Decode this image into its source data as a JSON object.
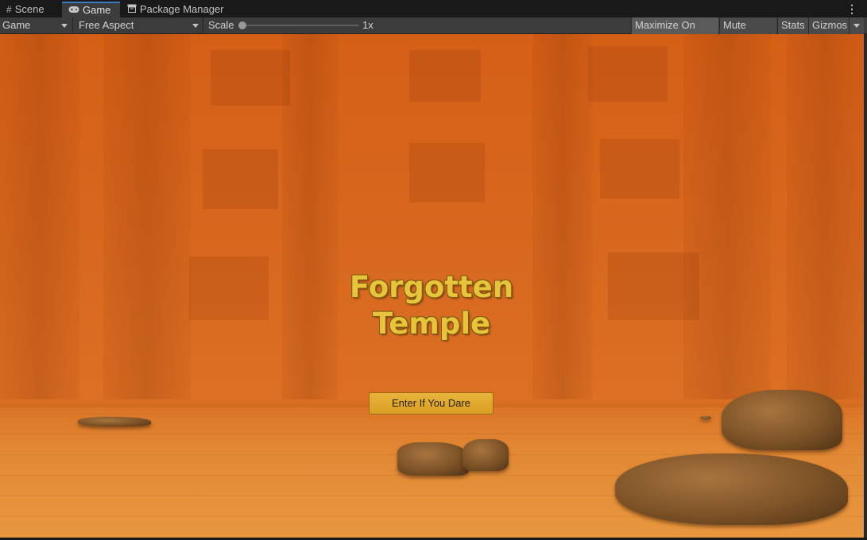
{
  "tabs": [
    {
      "label": "Scene",
      "icon": "hash-grid-icon"
    },
    {
      "label": "Game",
      "icon": "gamepad-icon",
      "active": true
    },
    {
      "label": "Package Manager",
      "icon": "package-icon"
    }
  ],
  "toolbar": {
    "display_select": "Game",
    "aspect_select": "Free Aspect",
    "scale_label": "Scale",
    "scale_value": "1x",
    "scale_level": 0.0,
    "maximize_label": "Maximize On Play",
    "mute_label": "Mute Audio",
    "stats_label": "Stats",
    "gizmos_label": "Gizmos"
  },
  "game": {
    "title_line1": "Forgotten",
    "title_line2": "Temple",
    "button_label": "Enter If You Dare",
    "colors": {
      "background": "#d4661e",
      "title": "#e8c43a",
      "button": "#e0aa30",
      "accent_tab": "#3a79bb"
    }
  }
}
